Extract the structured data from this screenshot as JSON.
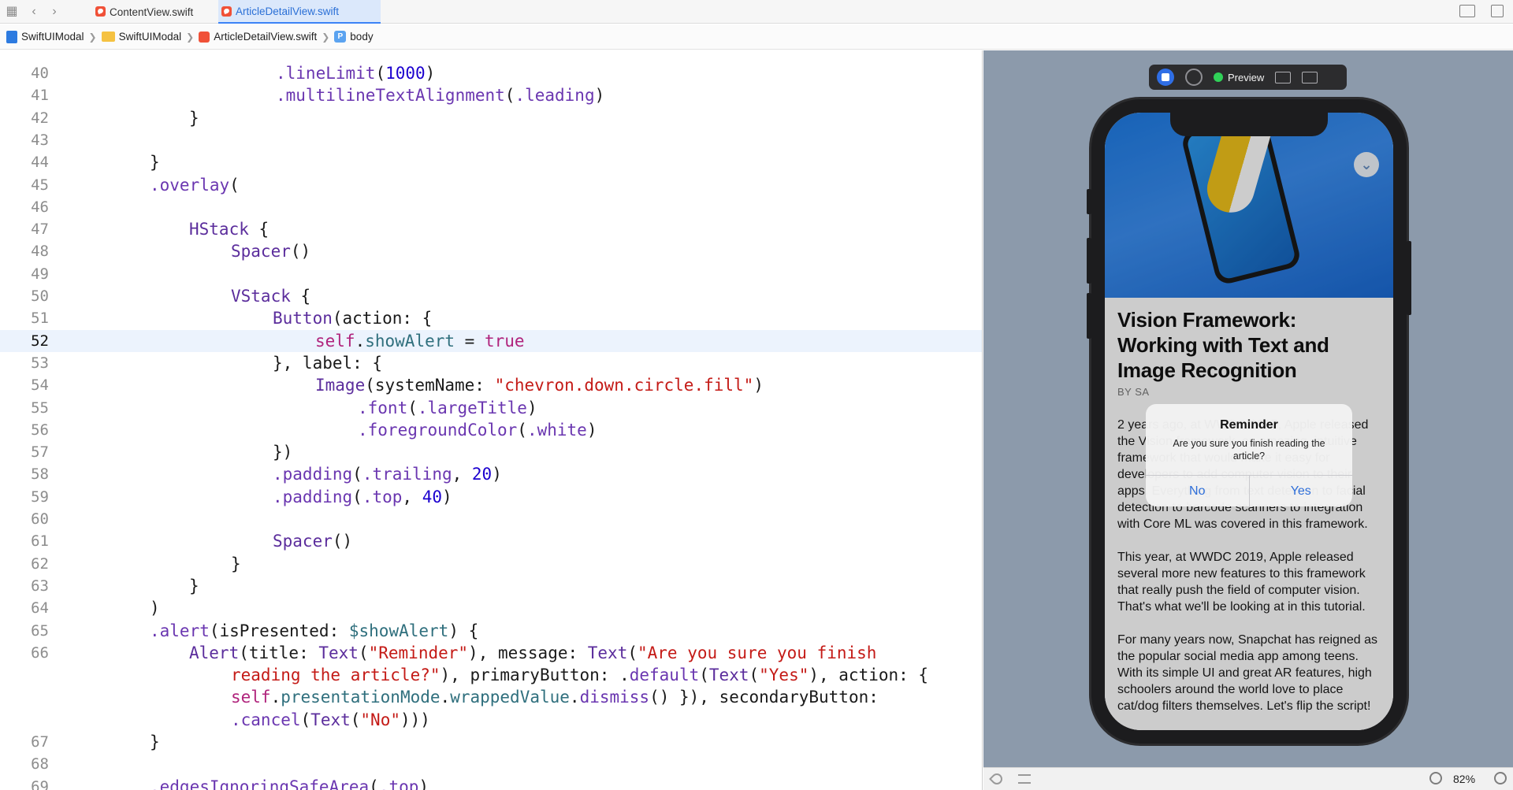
{
  "tabs": [
    {
      "label": "ContentView.swift",
      "active": false
    },
    {
      "label": "ArticleDetailView.swift",
      "active": true
    }
  ],
  "breadcrumb": [
    "SwiftUIModal",
    "SwiftUIModal",
    "ArticleDetailView.swift",
    "body"
  ],
  "editor": {
    "highlighted_line": "52",
    "lines": [
      {
        "n": "40",
        "html": "<span class=\"md\">.lineLimit</span>(<span class=\"nm\">1000</span>)"
      },
      {
        "n": "41",
        "html": "<span class=\"md\">.multilineTextAlignment</span>(<span class=\"md\">.leading</span>)"
      },
      {
        "n": "42",
        "html": "}"
      },
      {
        "n": "43",
        "html": ""
      },
      {
        "n": "44",
        "html": "}"
      },
      {
        "n": "45",
        "html": "<span class=\"md\">.overlay</span>("
      },
      {
        "n": "46",
        "html": ""
      },
      {
        "n": "47",
        "html": "<span class=\"ty\">HStack</span> {"
      },
      {
        "n": "48",
        "html": "<span class=\"ty\">Spacer</span>()"
      },
      {
        "n": "49",
        "html": ""
      },
      {
        "n": "50",
        "html": "<span class=\"ty\">VStack</span> {"
      },
      {
        "n": "51",
        "html": "<span class=\"ty\">Button</span>(action: {"
      },
      {
        "n": "52",
        "html": "<span class=\"kw\">self</span>.<span class=\"pr\">showAlert</span> = <span class=\"kw\">true</span>"
      },
      {
        "n": "53",
        "html": "}, label: {"
      },
      {
        "n": "54",
        "html": "<span class=\"ty\">Image</span>(systemName: <span class=\"st\">\"chevron.down.circle.fill\"</span>)"
      },
      {
        "n": "55",
        "html": "<span class=\"md\">.font</span>(<span class=\"md\">.largeTitle</span>)"
      },
      {
        "n": "56",
        "html": "<span class=\"md\">.foregroundColor</span>(<span class=\"md\">.white</span>)"
      },
      {
        "n": "57",
        "html": "})"
      },
      {
        "n": "58",
        "html": "<span class=\"md\">.padding</span>(<span class=\"md\">.trailing</span>, <span class=\"nm\">20</span>)"
      },
      {
        "n": "59",
        "html": "<span class=\"md\">.padding</span>(<span class=\"md\">.top</span>, <span class=\"nm\">40</span>)"
      },
      {
        "n": "60",
        "html": ""
      },
      {
        "n": "61",
        "html": "<span class=\"ty\">Spacer</span>()"
      },
      {
        "n": "62",
        "html": "}"
      },
      {
        "n": "63",
        "html": "}"
      },
      {
        "n": "64",
        "html": ")"
      },
      {
        "n": "65",
        "html": "<span class=\"md\">.alert</span>(isPresented: <span class=\"pr\">$showAlert</span>) {"
      },
      {
        "n": "66",
        "html": "<span class=\"ty\">Alert</span>(title: <span class=\"ty\">Text</span>(<span class=\"st\">\"Reminder\"</span>), message: <span class=\"ty\">Text</span>(<span class=\"st\">\"Are you sure you finish</span>"
      },
      {
        "n": "",
        "html": "<span class=\"st\">reading the article?\"</span>), primaryButton: .<span class=\"md\">default</span>(<span class=\"ty\">Text</span>(<span class=\"st\">\"Yes\"</span>), action: {"
      },
      {
        "n": "",
        "html": "<span class=\"kw\">self</span>.<span class=\"pr\">presentationMode</span>.<span class=\"pr\">wrappedValue</span>.<span class=\"md\">dismiss</span>() }), secondaryButton:"
      },
      {
        "n": "",
        "html": "<span class=\"md\">.cancel</span>(<span class=\"ty\">Text</span>(<span class=\"st\">\"No\"</span>)))"
      },
      {
        "n": "67",
        "html": "}"
      },
      {
        "n": "68",
        "html": ""
      },
      {
        "n": "69",
        "html": "<span class=\"md\">.edgesIgnoringSafeArea</span>(<span class=\"md\">.top</span>)"
      }
    ]
  },
  "preview_toolbar": {
    "label": "Preview"
  },
  "article": {
    "title": "Vision Framework: Working with Text and Image Recognition",
    "byline": "BY SA",
    "paragraphs": [
      "2 years ago, at WWDC 2017, Apple released the Vision framework, an amazing, intuitive framework that would make it easy for developers to add computer vision to their apps. Everything from text detection to facial detection to barcode scanners to integration with Core ML was covered in this framework.",
      "This year, at WWDC 2019, Apple released several more new features to this framework that really push the field of computer vision. That's what we'll be looking at in this tutorial.",
      "For many years now, Snapchat has reigned as the popular social media app among teens. With its simple UI and great AR features, high schoolers around the world love to place cat/dog filters themselves. Let's flip the script!"
    ]
  },
  "alert": {
    "title": "Reminder",
    "message": "Are you sure you finish reading the article?",
    "cancel_label": "No",
    "confirm_label": "Yes"
  },
  "preview_status": {
    "zoom": "82%"
  }
}
